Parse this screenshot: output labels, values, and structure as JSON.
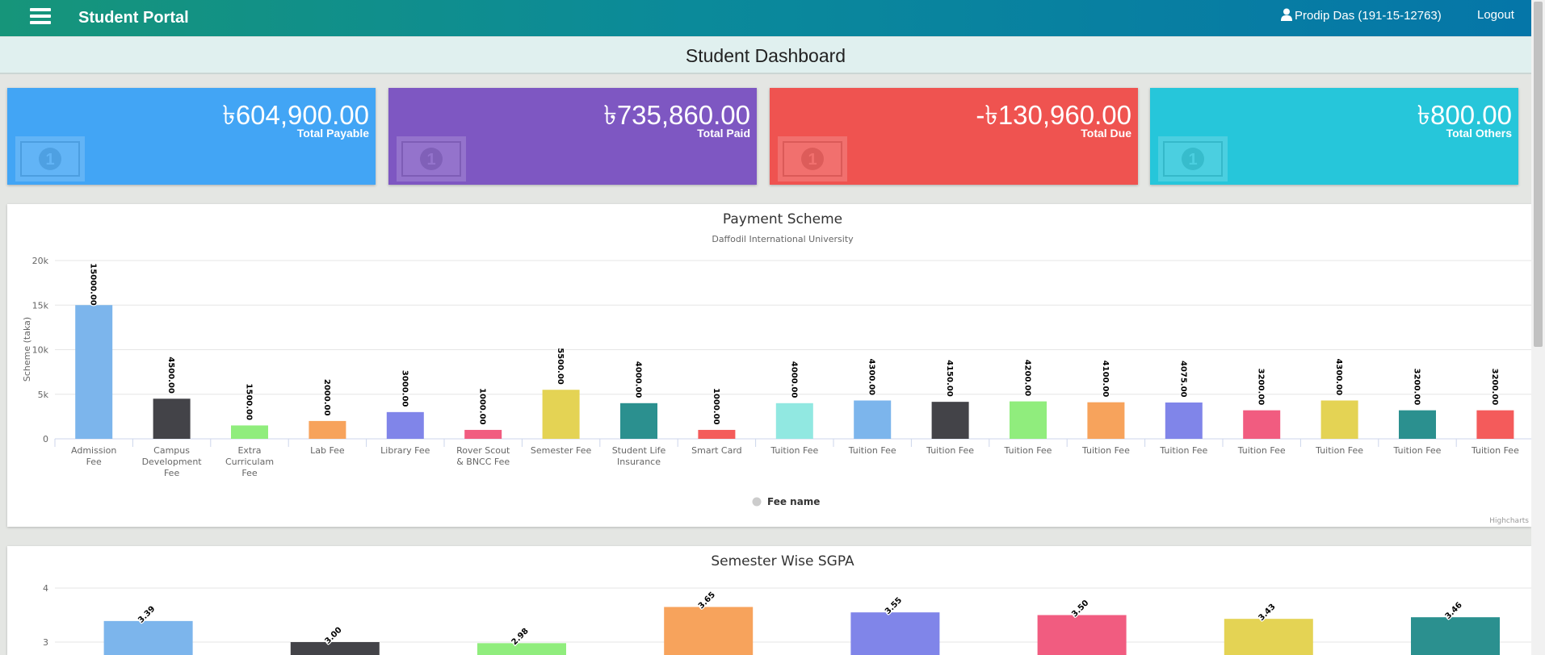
{
  "header": {
    "brand": "Student Portal",
    "user": "Prodip Das (191-15-12763)",
    "logout": "Logout"
  },
  "dashboard": {
    "title": "Student Dashboard"
  },
  "cards": [
    {
      "amount": "৳604,900.00",
      "label": "Total Payable",
      "color": "#42a5f5"
    },
    {
      "amount": "৳735,860.00",
      "label": "Total Paid",
      "color": "#7e57c2"
    },
    {
      "amount": "-৳130,960.00",
      "label": "Total Due",
      "color": "#ef5350"
    },
    {
      "amount": "৳800.00",
      "label": "Total Others",
      "color": "#26c6da"
    }
  ],
  "chart_data": [
    {
      "type": "bar",
      "title": "Payment Scheme",
      "subtitle": "Daffodil International University",
      "ylabel": "Scheme (taka)",
      "ylim": [
        0,
        20000
      ],
      "yticks": [
        "0",
        "5k",
        "10k",
        "15k",
        "20k"
      ],
      "categories": [
        "Admission Fee",
        "Campus Development Fee",
        "Extra Curriculam Fee",
        "Lab Fee",
        "Library Fee",
        "Rover Scout & BNCC Fee",
        "Semester Fee",
        "Student Life Insurance",
        "Smart Card",
        "Tuition Fee",
        "Tuition Fee",
        "Tuition Fee",
        "Tuition Fee",
        "Tuition Fee",
        "Tuition Fee",
        "Tuition Fee",
        "Tuition Fee",
        "Tuition Fee",
        "Tuition Fee"
      ],
      "values": [
        15000,
        4500,
        1500,
        2000,
        3000,
        1000,
        5500,
        4000,
        1000,
        4000,
        4300,
        4150,
        4200,
        4100,
        4075,
        3200,
        4300,
        3200,
        3200
      ],
      "data_labels": [
        "15000.00",
        "4500.00",
        "1500.00",
        "2000.00",
        "3000.00",
        "1000.00",
        "5500.00",
        "4000.00",
        "1000.00",
        "4000.00",
        "4300.00",
        "4150.00",
        "4200.00",
        "4100.00",
        "4075.00",
        "3200.00",
        "4300.00",
        "3200.00",
        "3200.00"
      ],
      "legend": {
        "label": "Fee name",
        "position": "bottom-center"
      },
      "credits": "Highcharts",
      "grid": true
    },
    {
      "type": "bar",
      "title": "Semester Wise SGPA",
      "ylim": [
        2,
        4
      ],
      "yticks": [
        "3",
        "4"
      ],
      "values": [
        3.39,
        3.0,
        2.98,
        3.65,
        3.55,
        3.5,
        3.43,
        3.46
      ],
      "data_labels": [
        "3.39",
        "3.00",
        "2.98",
        "3.65",
        "3.55",
        "3.50",
        "3.43",
        "3.46"
      ],
      "grid": true
    }
  ],
  "colors": {
    "palette": [
      "#7cb5ec",
      "#434348",
      "#90ed7d",
      "#f7a35c",
      "#8085e9",
      "#f15c80",
      "#e4d354",
      "#2b908f",
      "#f45b5b",
      "#91e8e1"
    ]
  },
  "icons": {
    "menu": "hamburger-icon",
    "user": "user-icon",
    "money": "money-bill-icon"
  }
}
